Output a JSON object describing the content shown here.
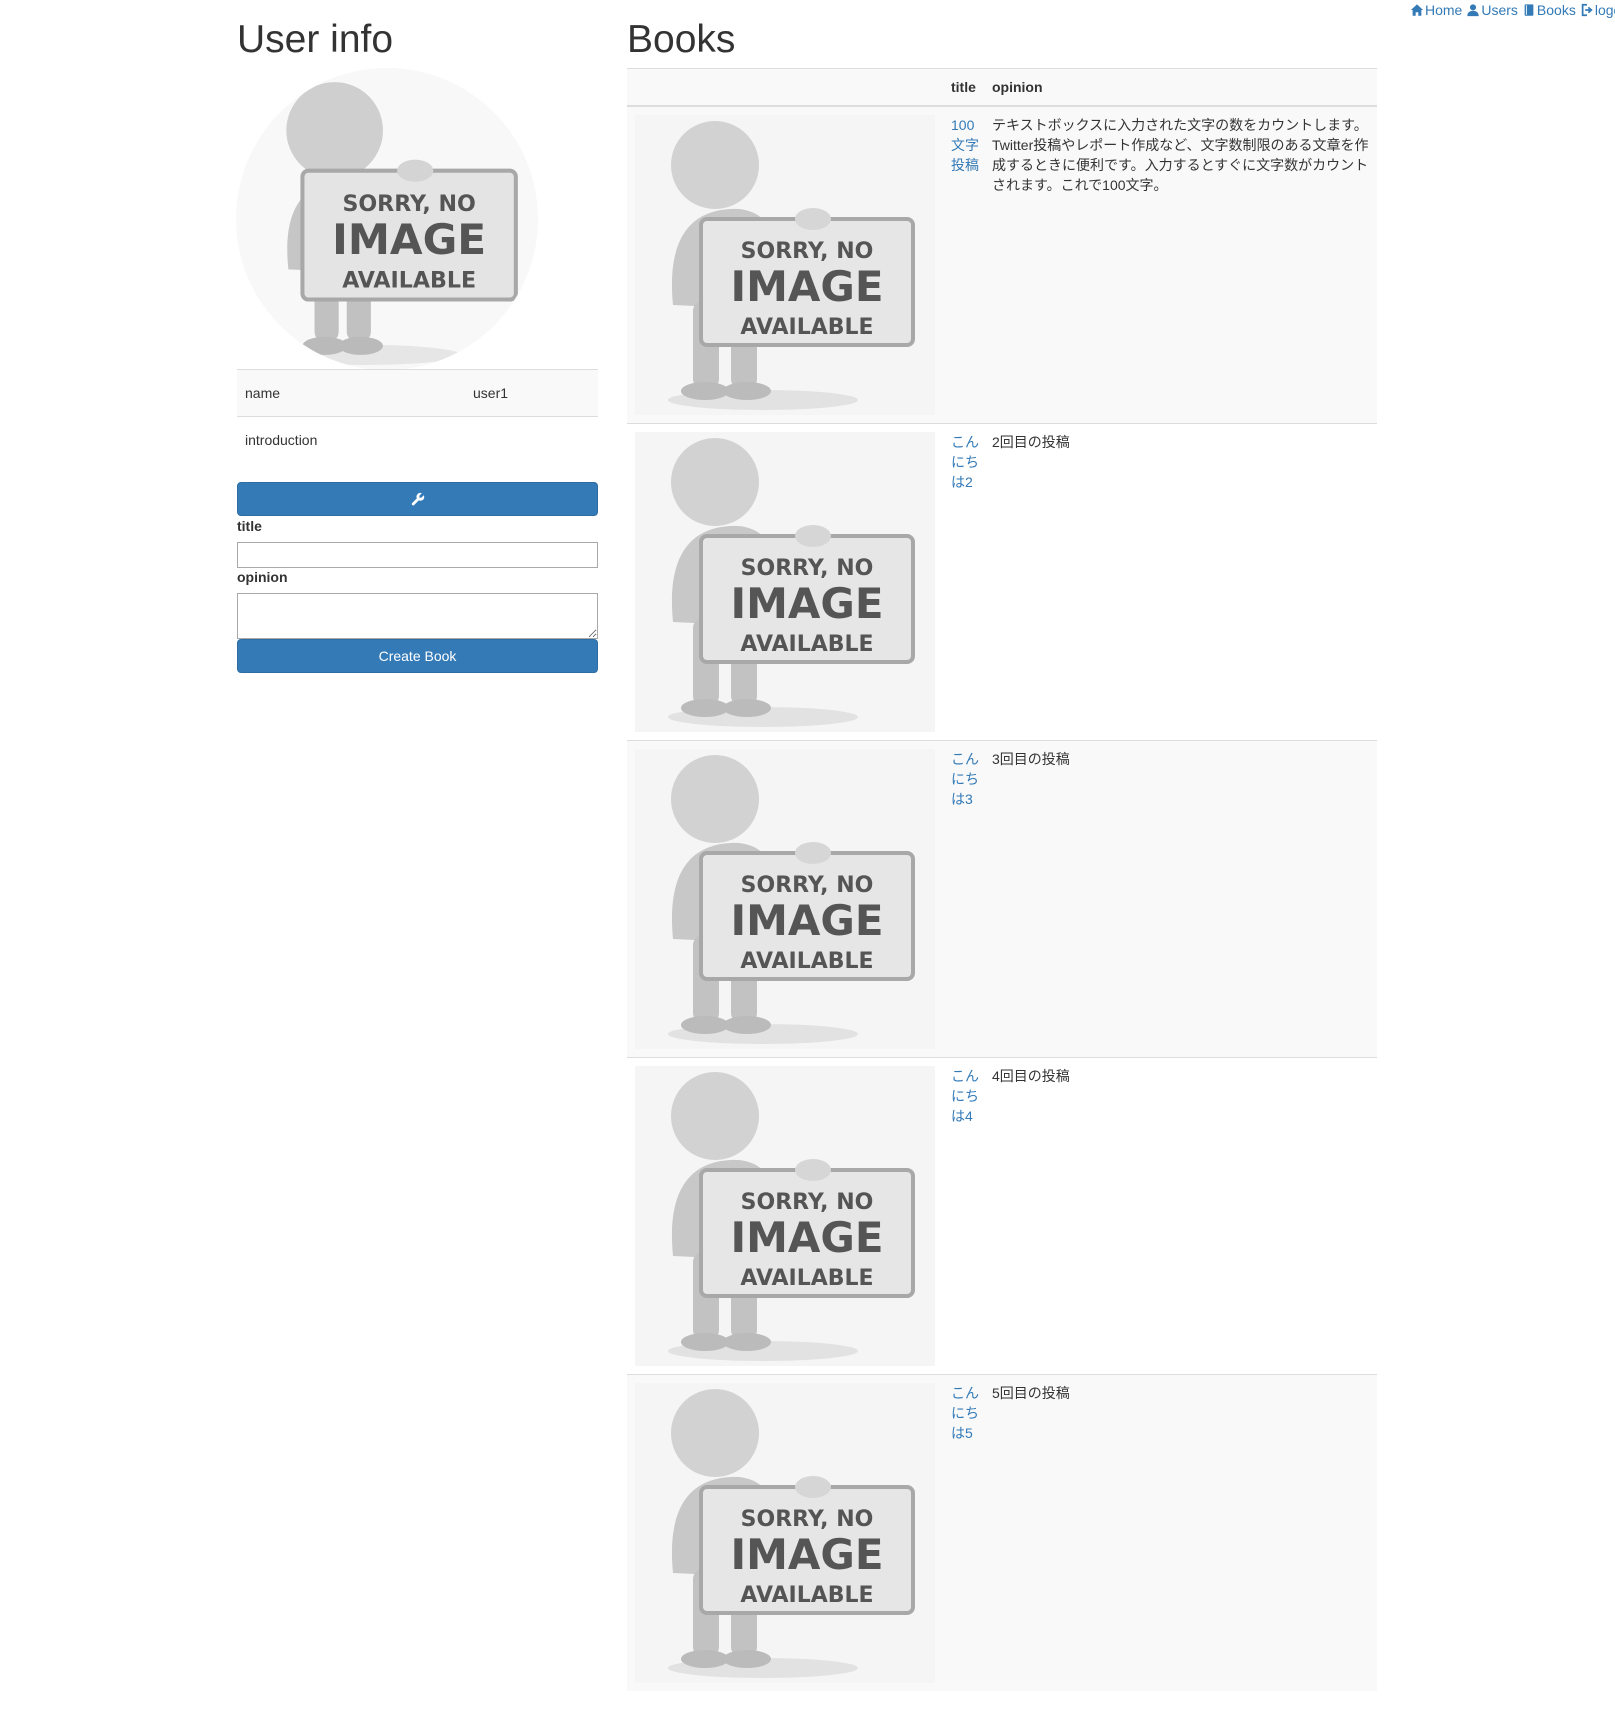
{
  "nav": {
    "home": "Home",
    "users": "Users",
    "books": "Books",
    "logout": "logout"
  },
  "user_info": {
    "heading": "User info",
    "placeholder": {
      "line1": "SORRY, NO",
      "line2": "IMAGE",
      "line3": "AVAILABLE"
    },
    "rows": [
      {
        "label": "name",
        "value": "user1"
      },
      {
        "label": "introduction",
        "value": ""
      }
    ],
    "edit_icon": "wrench-icon"
  },
  "form": {
    "title_label": "title",
    "opinion_label": "opinion",
    "title_value": "",
    "opinion_value": "",
    "submit_label": "Create Book"
  },
  "books": {
    "heading": "Books",
    "headers": {
      "image": "",
      "title": "title",
      "opinion": "opinion"
    },
    "rows": [
      {
        "title": "100文字投稿",
        "opinion": "テキストボックスに入力された文字の数をカウントします。 Twitter投稿やレポート作成など、文字数制限のある文章を作成するときに便利です。入力するとすぐに文字数がカウントされます。これで100文字。"
      },
      {
        "title": "こんにちは2",
        "opinion": "2回目の投稿"
      },
      {
        "title": "こんにちは3",
        "opinion": "3回目の投稿"
      },
      {
        "title": "こんにちは4",
        "opinion": "4回目の投稿"
      },
      {
        "title": "こんにちは5",
        "opinion": "5回目の投稿"
      }
    ]
  },
  "colors": {
    "link": "#337ab7",
    "primary_button": "#337ab7",
    "table_stripe": "#f9f9f9",
    "border": "#dddddd"
  }
}
